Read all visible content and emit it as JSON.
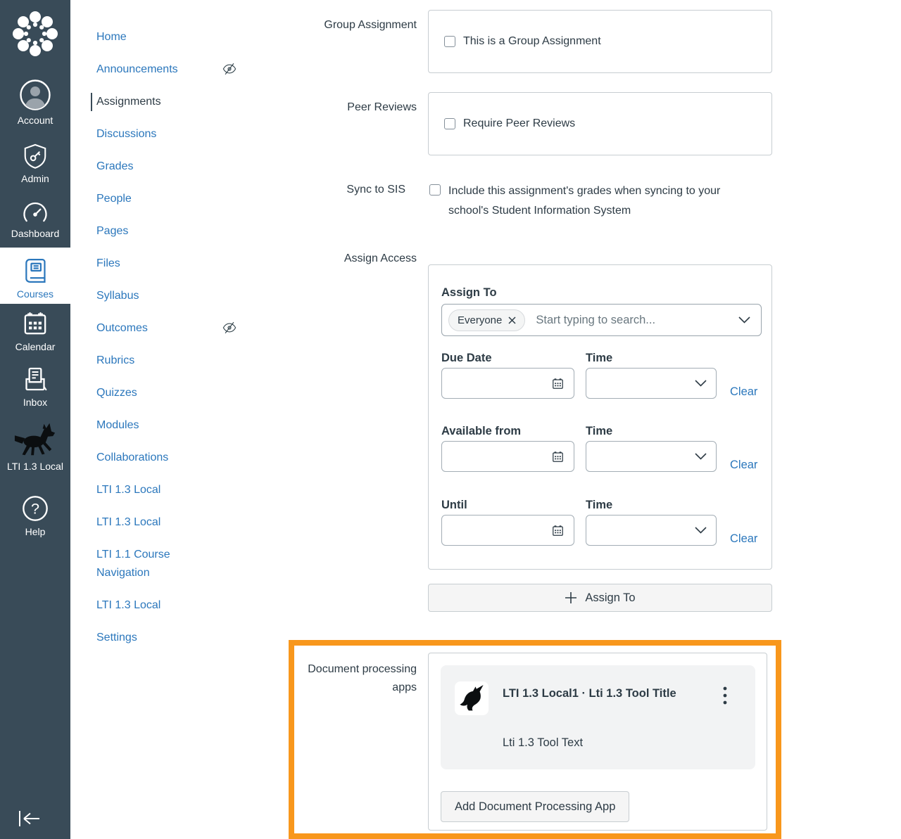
{
  "colors": {
    "sidebar_bg": "#394B58",
    "link_blue": "#2B77BC",
    "text_dark": "#2D3B45",
    "border_gray": "#C7CDD1",
    "highlight_orange": "#F8971C",
    "app_card_gray": "#F2F3F4"
  },
  "global_nav": {
    "items": [
      {
        "label": "Account"
      },
      {
        "label": "Admin"
      },
      {
        "label": "Dashboard"
      },
      {
        "label": "Courses",
        "active": true
      },
      {
        "label": "Calendar"
      },
      {
        "label": "Inbox"
      },
      {
        "label": "LTI 1.3 Local"
      },
      {
        "label": "Help"
      }
    ]
  },
  "course_nav": {
    "items": [
      {
        "label": "Home"
      },
      {
        "label": "Announcements",
        "hidden": true
      },
      {
        "label": "Assignments",
        "active": true
      },
      {
        "label": "Discussions"
      },
      {
        "label": "Grades"
      },
      {
        "label": "People"
      },
      {
        "label": "Pages"
      },
      {
        "label": "Files"
      },
      {
        "label": "Syllabus"
      },
      {
        "label": "Outcomes",
        "hidden": true
      },
      {
        "label": "Rubrics"
      },
      {
        "label": "Quizzes"
      },
      {
        "label": "Modules"
      },
      {
        "label": "Collaborations"
      },
      {
        "label": "LTI 1.3 Local"
      },
      {
        "label": "LTI 1.3 Local"
      },
      {
        "label": "LTI 1.1 Course Navigation"
      },
      {
        "label": "LTI 1.3 Local"
      },
      {
        "label": "Settings"
      }
    ]
  },
  "form": {
    "group_assignment": {
      "row_label": "Group Assignment",
      "checkbox_label": "This is a Group Assignment",
      "checked": false
    },
    "peer_reviews": {
      "row_label": "Peer Reviews",
      "checkbox_label": "Require Peer Reviews",
      "checked": false
    },
    "sync_to_sis": {
      "row_label": "Sync to SIS",
      "checkbox_label": "Include this assignment's grades when syncing to your school's Student Information System",
      "checked": false
    },
    "assign_access": {
      "row_label": "Assign Access",
      "assign_to_heading": "Assign To",
      "selected_tag": "Everyone",
      "search_placeholder": "Start typing to search...",
      "rows": [
        {
          "date_label": "Due Date",
          "time_label": "Time",
          "clear": "Clear"
        },
        {
          "date_label": "Available from",
          "time_label": "Time",
          "clear": "Clear"
        },
        {
          "date_label": "Until",
          "time_label": "Time",
          "clear": "Clear"
        }
      ],
      "add_assign_button": "Assign To"
    },
    "document_processing": {
      "row_label": "Document processing apps",
      "app_title": "LTI 1.3 Local1 · Lti 1.3 Tool Title",
      "app_description": "Lti 1.3 Tool Text",
      "add_button": "Add Document Processing App"
    }
  }
}
